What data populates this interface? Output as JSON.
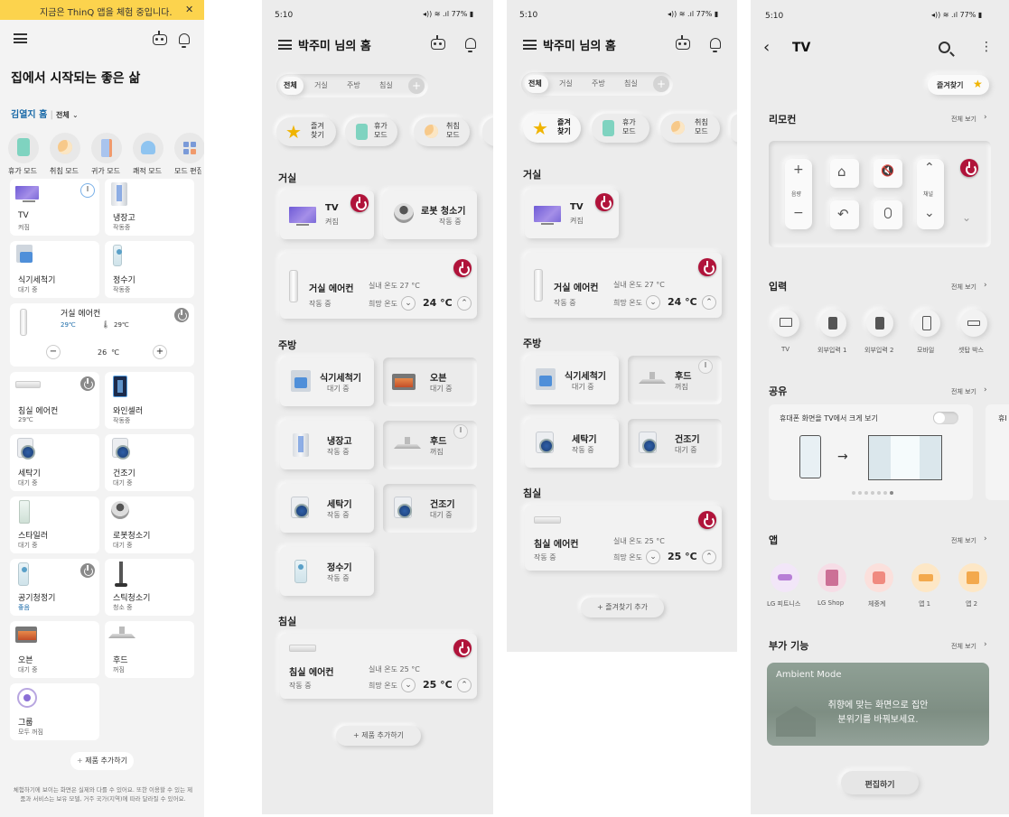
{
  "s1": {
    "banner": "지금은 ThinQ 앱을 체험 중입니다.",
    "banner_close": "✕",
    "title": "집에서 시작되는 좋은 삶",
    "home_name": "김열지 홈",
    "filter": "전체",
    "modes": [
      "휴가 모드",
      "취침 모드",
      "귀가 모드",
      "쾌적 모드",
      "모드 편집"
    ],
    "tiles": [
      {
        "name": "TV",
        "status": "켜짐"
      },
      {
        "name": "냉장고",
        "status": "작동중"
      },
      {
        "name": "식기세척기",
        "status": "대기 중"
      },
      {
        "name": "정수기",
        "status": "작동중"
      },
      {
        "name": "침실 에어컨",
        "status": "29℃"
      },
      {
        "name": "와인셀러",
        "status": "작동중"
      },
      {
        "name": "세탁기",
        "status": "대기 중"
      },
      {
        "name": "건조기",
        "status": "대기 중"
      },
      {
        "name": "스타일러",
        "status": "대기 중"
      },
      {
        "name": "로봇청소기",
        "status": "대기 중"
      },
      {
        "name": "공기청정기",
        "status": "좋음"
      },
      {
        "name": "스틱청소기",
        "status": "청소 중"
      },
      {
        "name": "오븐",
        "status": "대기 중"
      },
      {
        "name": "후드",
        "status": "꺼짐"
      },
      {
        "name": "그룹",
        "status": "모두 꺼짐"
      }
    ],
    "ac": {
      "name": "거실 에어컨",
      "t1": "29℃",
      "t2": "29℃",
      "minus": "−",
      "set": "26",
      "unit": "℃",
      "plus": "+"
    },
    "add": "제품 추가하기",
    "footer": "체험하기에 보이는 화면은 실제와 다를 수 있어요. 또한 이용할 수 있는 제품과 서비스는 보유 모델, 거주 국가(지역)에 따라 달라질 수 있어요."
  },
  "s2": {
    "time": "5:10",
    "status": "77%",
    "title": "박주미 님의 홈",
    "tabs": [
      "전체",
      "거실",
      "주방",
      "침실"
    ],
    "modes": [
      "즐겨\n찾기",
      "휴가\n모드",
      "취침\n모드"
    ],
    "living": "거실",
    "kitchen": "주방",
    "bedroom": "침실",
    "tv": {
      "name": "TV",
      "status": "켜짐"
    },
    "robot": {
      "name": "로봇 청소기",
      "status": "작동 중"
    },
    "ac": {
      "name": "거실 에어컨",
      "status": "작동 중",
      "indoor": "실내 온도 27 °C",
      "wish": "희망 온도",
      "temp": "24 °C"
    },
    "k": [
      {
        "name": "식기세척기",
        "status": "대기 중"
      },
      {
        "name": "오븐",
        "status": "대기 중"
      },
      {
        "name": "냉장고",
        "status": "작동 중"
      },
      {
        "name": "후드",
        "status": "꺼짐"
      },
      {
        "name": "세탁기",
        "status": "작동 중"
      },
      {
        "name": "건조기",
        "status": "대기 중"
      },
      {
        "name": "정수기",
        "status": "작동 중"
      }
    ],
    "bac": {
      "name": "침실 에어컨",
      "status": "작동 중",
      "indoor": "실내 온도 25 °C",
      "wish": "희망 온도",
      "temp": "25 °C"
    },
    "add": "제품 추가하기"
  },
  "s3": {
    "time": "5:10",
    "status": "77%",
    "title": "박주미 님의 홈",
    "tabs": [
      "전체",
      "거실",
      "주방",
      "침실"
    ],
    "modes": [
      "즐겨\n찾기",
      "휴가\n모드",
      "취침\n모드"
    ],
    "living": "거실",
    "kitchen": "주방",
    "bedroom": "침실",
    "tv": {
      "name": "TV",
      "status": "켜짐"
    },
    "ac": {
      "name": "거실 에어컨",
      "status": "작동 중",
      "indoor": "실내 온도 27 °C",
      "wish": "희망 온도",
      "temp": "24 °C"
    },
    "k": [
      {
        "name": "식기세척기",
        "status": "대기 중"
      },
      {
        "name": "후드",
        "status": "꺼짐"
      },
      {
        "name": "세탁기",
        "status": "작동 중"
      },
      {
        "name": "건조기",
        "status": "대기 중"
      }
    ],
    "bac": {
      "name": "침실 에어컨",
      "status": "작동 중",
      "indoor": "실내 온도 25 °C",
      "wish": "희망 온도",
      "temp": "25 °C"
    },
    "add": "즐겨찾기 추가"
  },
  "s4": {
    "time": "5:10",
    "status": "77%",
    "title": "TV",
    "fav": "즐겨찾기",
    "remote": "리모컨",
    "see_all": "전체 보기",
    "vol": "음량",
    "ch": "채널",
    "input": "입력",
    "inputs": [
      "TV",
      "외부입력 1",
      "외부입력 2",
      "모바일",
      "셋탑 박스"
    ],
    "share": "공유",
    "share_title": "휴대폰 화면을 TV에서 크게 보기",
    "share_peek": "휴I",
    "app": "앱",
    "apps": [
      "LG 피트니스",
      "LG Shop",
      "체중계",
      "앱 1",
      "앱 2"
    ],
    "extra": "부가 기능",
    "ambient": "Ambient Mode",
    "ambient_desc": "취향에 맞는 화면으로 집안\n분위기를 바꿔보세요.",
    "edit": "편집하기"
  }
}
